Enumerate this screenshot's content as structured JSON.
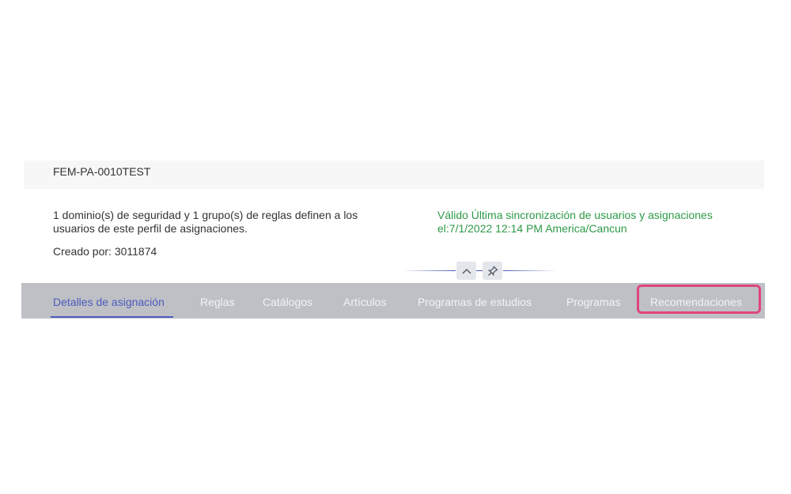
{
  "header": {
    "title": "FEM-PA-0010TEST"
  },
  "summary": {
    "description": "1 dominio(s) de seguridad y 1 grupo(s) de reglas definen a los usuarios de este perfil de asignaciones.",
    "created_by": "Creado por: 3011874",
    "status": "Válido Última sincronización de usuarios y asignaciones el:7/1/2022 12:14 PM America/Cancun",
    "status_color": "#2e9a48"
  },
  "controls": {
    "collapse_icon": "chevron-up-icon",
    "pin_icon": "pin-icon"
  },
  "tabs": [
    {
      "label": "Detalles de asignación",
      "active": true
    },
    {
      "label": "Reglas",
      "active": false
    },
    {
      "label": "Catálogos",
      "active": false
    },
    {
      "label": "Artículos",
      "active": false
    },
    {
      "label": "Programas de estudios",
      "active": false
    },
    {
      "label": "Programas",
      "active": false
    },
    {
      "label": "Recomendaciones",
      "active": false,
      "highlighted": true
    }
  ],
  "colors": {
    "accent": "#4f5bbd",
    "tabbar_bg": "#bec0c5",
    "highlight": "#e0457b"
  }
}
